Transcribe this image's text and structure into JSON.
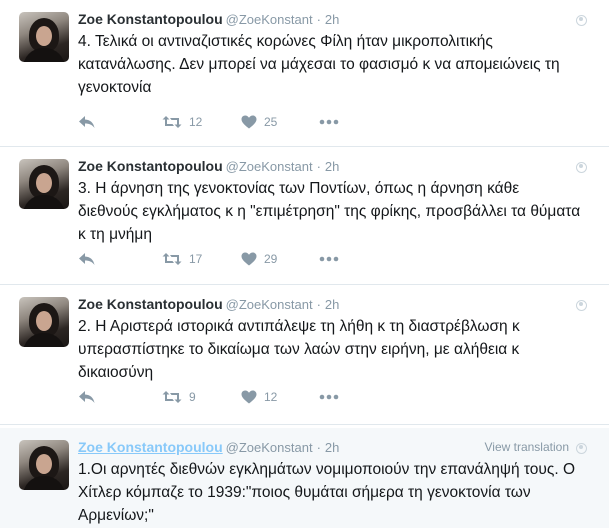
{
  "tweets": [
    {
      "name": "Zoe Konstantopoulou",
      "handle": "@ZoeKonstant",
      "separator": "·",
      "time": "2h",
      "text": "4. Τελικά οι αντιναζιστικές κορώνες Φίλη ήταν μικροπολιτικής κατανάλωσης. Δεν μπορεί να μάχεσαι το φασισμό κ να απομειώνεις τη γενοκτονία",
      "retweets": "12",
      "likes": "25"
    },
    {
      "name": "Zoe Konstantopoulou",
      "handle": "@ZoeKonstant",
      "separator": "·",
      "time": "2h",
      "text": "3. Η άρνηση της γενοκτονίας των Ποντίων, όπως η άρνηση κάθε διεθνούς εγκλήματος κ η \"επιμέτρηση\" της φρίκης, προσβάλλει τα θύματα κ τη μνήμη",
      "retweets": "17",
      "likes": "29"
    },
    {
      "name": "Zoe Konstantopoulou",
      "handle": "@ZoeKonstant",
      "separator": "·",
      "time": "2h",
      "text": "2. Η Αριστερά ιστορικά αντιπάλεψε τη λήθη κ τη διαστρέβλωση κ υπερασπίστηκε το δικαίωμα των λαών στην ειρήνη, με αλήθεια κ δικαιοσύνη",
      "retweets": "9",
      "likes": "12"
    },
    {
      "name": "Zoe Konstantopoulou",
      "handle": "@ZoeKonstant",
      "separator": "·",
      "time": "2h",
      "view_translation": "View translation",
      "text": "1.Οι αρνητές διεθνών εγκλημάτων νομιμοποιούν την επανάληψή τους. Ο Χίτλερ κόμπαζε το 1939:\"ποιος θυμάται σήμερα τη γενοκτονία των Αρμενίων;\""
    }
  ],
  "icons": {
    "reply": "reply-icon",
    "retweet": "retweet-icon",
    "like": "heart-icon",
    "more": "more-icon",
    "globe": "globe-icon"
  },
  "colors": {
    "icon": "#8899a6",
    "name_link": "#88c9f9",
    "hover_bg": "#f5f8fa"
  }
}
